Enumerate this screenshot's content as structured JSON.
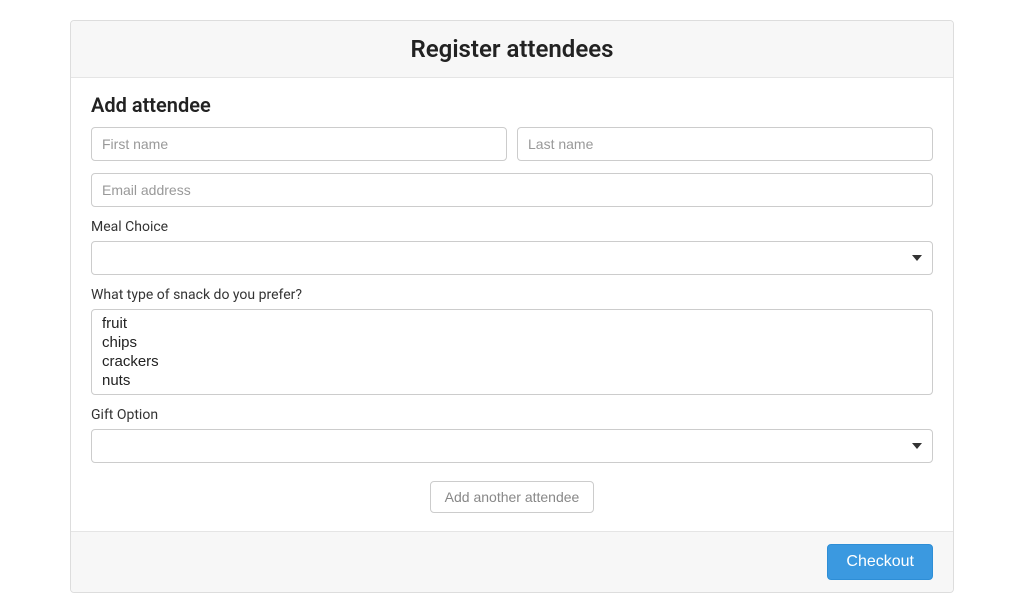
{
  "header": {
    "title": "Register attendees"
  },
  "form": {
    "section_title": "Add attendee",
    "first_name": {
      "placeholder": "First name",
      "value": ""
    },
    "last_name": {
      "placeholder": "Last name",
      "value": ""
    },
    "email": {
      "placeholder": "Email address",
      "value": ""
    },
    "meal": {
      "label": "Meal Choice",
      "value": ""
    },
    "snack": {
      "label": "What type of snack do you prefer?",
      "options": [
        "fruit",
        "chips",
        "crackers",
        "nuts"
      ]
    },
    "gift": {
      "label": "Gift Option",
      "value": ""
    },
    "add_another_label": "Add another attendee"
  },
  "footer": {
    "checkout_label": "Checkout"
  }
}
